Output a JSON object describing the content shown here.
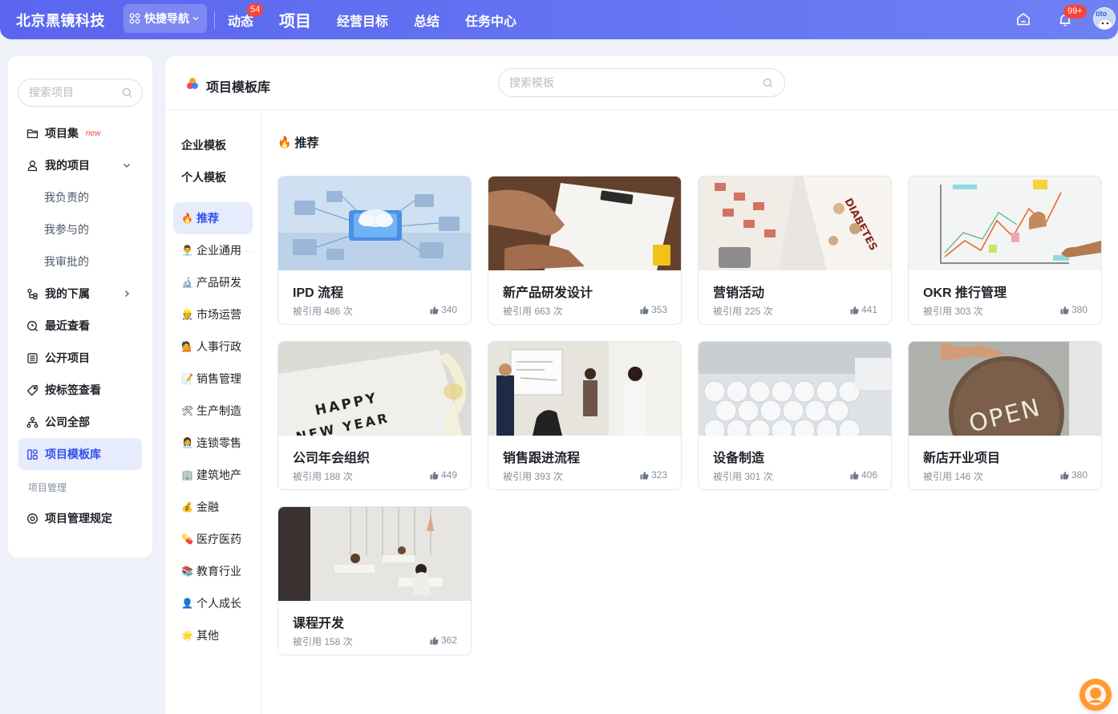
{
  "app": {
    "brand": "北京黑镜科技"
  },
  "topnav": {
    "quicknav_label": "快捷导航",
    "items": [
      {
        "label": "动态",
        "badge": "54"
      },
      {
        "label": "项目"
      },
      {
        "label": "经营目标"
      },
      {
        "label": "总结"
      },
      {
        "label": "任务中心"
      }
    ],
    "notification_badge": "99+",
    "avatar_text": "tito"
  },
  "sidebar": {
    "search_placeholder": "搜索项目",
    "items": [
      {
        "label": "项目集",
        "tag": "new",
        "icon": "folder-icon"
      },
      {
        "label": "我的项目",
        "icon": "user-icon"
      },
      {
        "label": "我负责的"
      },
      {
        "label": "我参与的"
      },
      {
        "label": "我审批的"
      },
      {
        "label": "我的下属",
        "icon": "org-icon"
      },
      {
        "label": "最近查看",
        "icon": "recent-icon"
      },
      {
        "label": "公开项目",
        "icon": "list-icon"
      },
      {
        "label": "按标签查看",
        "icon": "tag-icon"
      },
      {
        "label": "公司全部",
        "icon": "company-icon"
      },
      {
        "label": "项目模板库",
        "icon": "template-icon"
      },
      {
        "label": "项目管理规定",
        "icon": "rules-icon"
      }
    ],
    "group_label": "项目管理"
  },
  "main": {
    "title": "项目模板库",
    "search_placeholder": "搜索模板",
    "section_title": "推荐",
    "categories": [
      {
        "label": "企业模板",
        "emoji": ""
      },
      {
        "label": "个人模板",
        "emoji": ""
      },
      {
        "label": "推荐",
        "emoji": "🔥"
      },
      {
        "label": "企业通用",
        "emoji": "👨‍💼"
      },
      {
        "label": "产品研发",
        "emoji": "🔬"
      },
      {
        "label": "市场运营",
        "emoji": "👷"
      },
      {
        "label": "人事行政",
        "emoji": "💁"
      },
      {
        "label": "销售管理",
        "emoji": "📝"
      },
      {
        "label": "生产制造",
        "emoji": "🛠"
      },
      {
        "label": "连锁零售",
        "emoji": "👩‍💼"
      },
      {
        "label": "建筑地产",
        "emoji": "🏢"
      },
      {
        "label": "金融",
        "emoji": "💰"
      },
      {
        "label": "医疗医药",
        "emoji": "💊"
      },
      {
        "label": "教育行业",
        "emoji": "📚"
      },
      {
        "label": "个人成长",
        "emoji": "👤"
      },
      {
        "label": "其他",
        "emoji": "🌟"
      }
    ],
    "cards": [
      {
        "title": "IPD 流程",
        "uses": "被引用 486 次",
        "likes": "340"
      },
      {
        "title": "新产品研发设计",
        "uses": "被引用 663 次",
        "likes": "353"
      },
      {
        "title": "营销活动",
        "uses": "被引用 225 次",
        "likes": "441"
      },
      {
        "title": "OKR 推行管理",
        "uses": "被引用 303 次",
        "likes": "380"
      },
      {
        "title": "公司年会组织",
        "uses": "被引用 188 次",
        "likes": "449"
      },
      {
        "title": "销售跟进流程",
        "uses": "被引用 393 次",
        "likes": "323"
      },
      {
        "title": "设备制造",
        "uses": "被引用 301 次",
        "likes": "406"
      },
      {
        "title": "新店开业项目",
        "uses": "被引用 146 次",
        "likes": "380"
      },
      {
        "title": "课程开发",
        "uses": "被引用 158 次",
        "likes": "362"
      }
    ],
    "thumb_text": {
      "diabetes": "DIABETES",
      "happy": "HAPPY",
      "new_year": "NEW YEAR",
      "open": "OPEN"
    }
  },
  "colors": {
    "accent": "#3350e8",
    "topbar": "#5a66ee",
    "badge": "#f5453b"
  }
}
